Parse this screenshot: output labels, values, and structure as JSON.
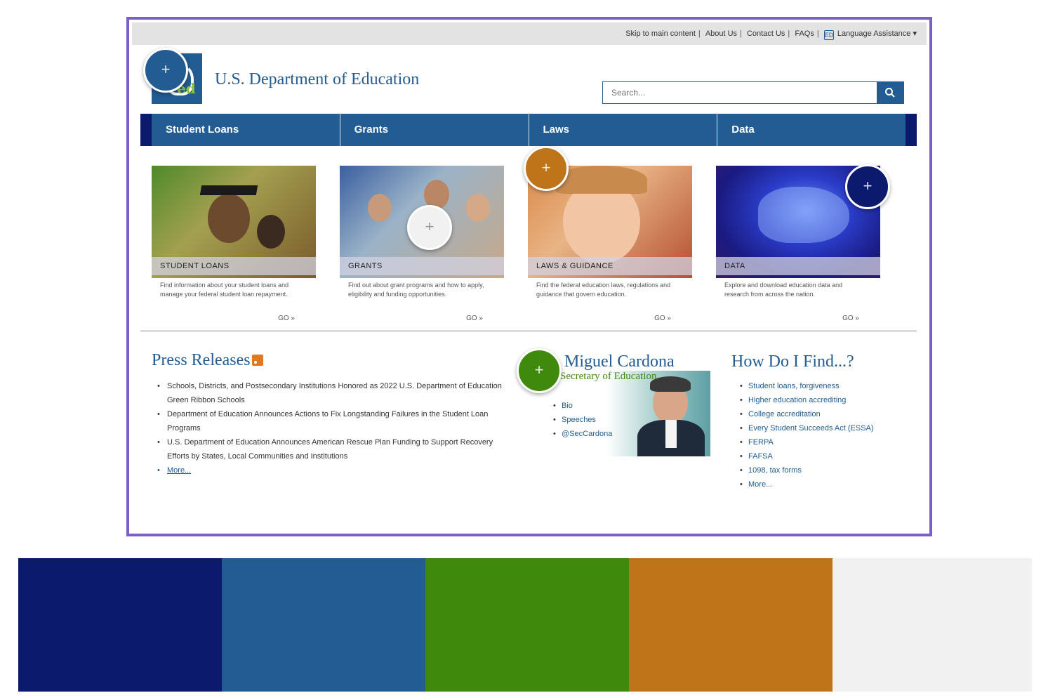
{
  "utility_links": {
    "skip": "Skip to main content",
    "about": "About Us",
    "contact": "Contact Us",
    "faqs": "FAQs",
    "language_icon": "ED",
    "language": "Language Assistance ▾"
  },
  "header": {
    "site_title": "U.S. Department of Education",
    "logo_text": "ed",
    "search_placeholder": "Search..."
  },
  "nav": {
    "items": [
      "Student Loans",
      "Grants",
      "Laws",
      "Data"
    ]
  },
  "cards": [
    {
      "caption": "STUDENT LOANS",
      "desc": "Find information about your student loans and manage your federal student loan repayment.",
      "link": "GO »"
    },
    {
      "caption": "GRANTS",
      "desc": "Find out about grant programs and how to apply, eligibility and funding opportunities.",
      "link": "GO »"
    },
    {
      "caption": "LAWS & GUIDANCE",
      "desc": "Find the federal education laws, regulations and guidance that govern education.",
      "link": "GO »"
    },
    {
      "caption": "DATA",
      "desc": "Explore and download education data and research from across the nation.",
      "link": "GO »"
    }
  ],
  "press": {
    "title": "Press Releases",
    "items": [
      "Schools, Districts, and Postsecondary Institutions Honored as 2022 U.S. Department of Education Green Ribbon Schools",
      "Department of Education Announces Actions to Fix Longstanding Failures in the Student Loan Programs",
      "U.S. Department of Education Announces American Rescue Plan Funding to Support Recovery Efforts by States, Local Communities and Institutions",
      "More..."
    ]
  },
  "secretary": {
    "name": "Miguel Cardona",
    "role": "Secretary of Education",
    "links": [
      "Bio",
      "Speeches",
      "@SecCardona"
    ]
  },
  "find": {
    "title": "How Do I Find...?",
    "items": [
      "Student loans, forgiveness",
      "Higher education accrediting",
      "College accreditation",
      "Every Student Succeeds Act (ESSA)",
      "FERPA",
      "FAFSA",
      "1098, tax forms",
      "More..."
    ]
  },
  "markers": {
    "symbol": "+",
    "colors": {
      "navy": "#0c1a6e",
      "blue": "#225c92",
      "green": "#3f8a0d",
      "orange": "#c0741a",
      "light": "#f1f1f1"
    }
  },
  "palette": [
    "#0c1a6e",
    "#225c92",
    "#3f8a0d",
    "#c0741a",
    "#f1f1f1"
  ]
}
